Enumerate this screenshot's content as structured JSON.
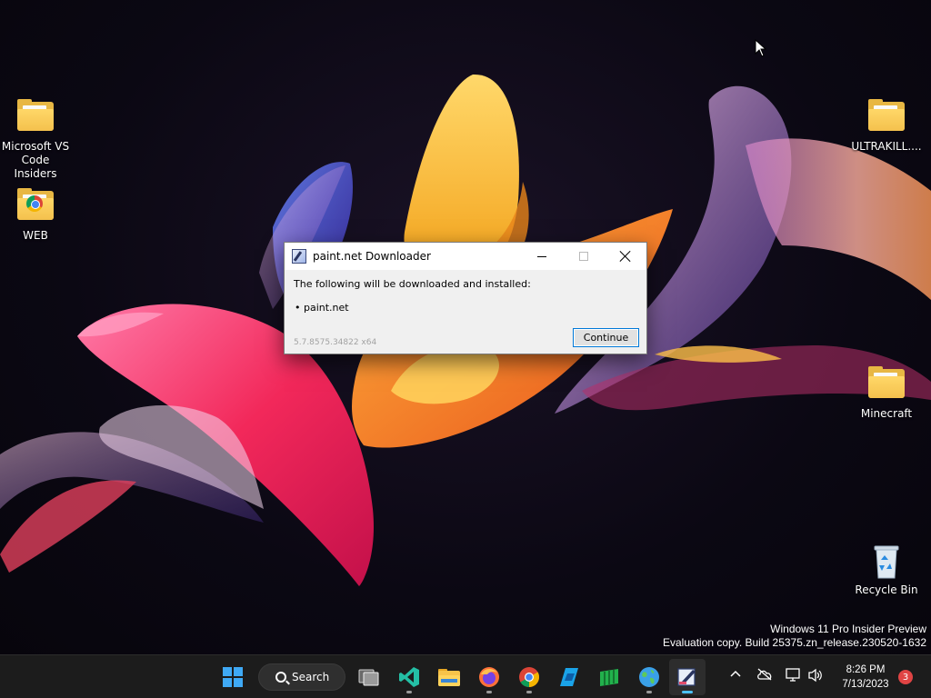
{
  "desktop": {
    "icons": [
      {
        "label": "Microsoft VS Code Insiders",
        "type": "folder"
      },
      {
        "label": "WEB",
        "type": "folder-chrome"
      },
      {
        "label": "ULTRAKILL....",
        "type": "folder"
      },
      {
        "label": "Minecraft",
        "type": "folder"
      },
      {
        "label": "Recycle Bin",
        "type": "recycle-bin"
      }
    ]
  },
  "dialog": {
    "title": "paint.net Downloader",
    "message": "The following will be downloaded and installed:",
    "item": "• paint.net",
    "version": "5.7.8575.34822 x64",
    "continue_label": "Continue"
  },
  "watermark": {
    "line1": "Windows 11 Pro Insider Preview",
    "line2": "Evaluation copy. Build 25375.zn_release.230520-1632"
  },
  "taskbar": {
    "search_label": "Search",
    "apps": [
      "windows-start-icon",
      "task-view-icon",
      "vscode-icon",
      "file-explorer-icon",
      "firefox-icon",
      "chrome-icon",
      "app-blue-icon",
      "app-green-icon",
      "world-icon",
      "paintnet-icon"
    ],
    "clock_time": "8:26 PM",
    "clock_date": "7/13/2023",
    "notification_count": "3"
  },
  "colors": {
    "accent": "#4cc2ff",
    "taskbar_bg": "#1c1c1c",
    "dialog_bg": "#f0f0f0",
    "folder_yellow": "#f4c14d"
  }
}
